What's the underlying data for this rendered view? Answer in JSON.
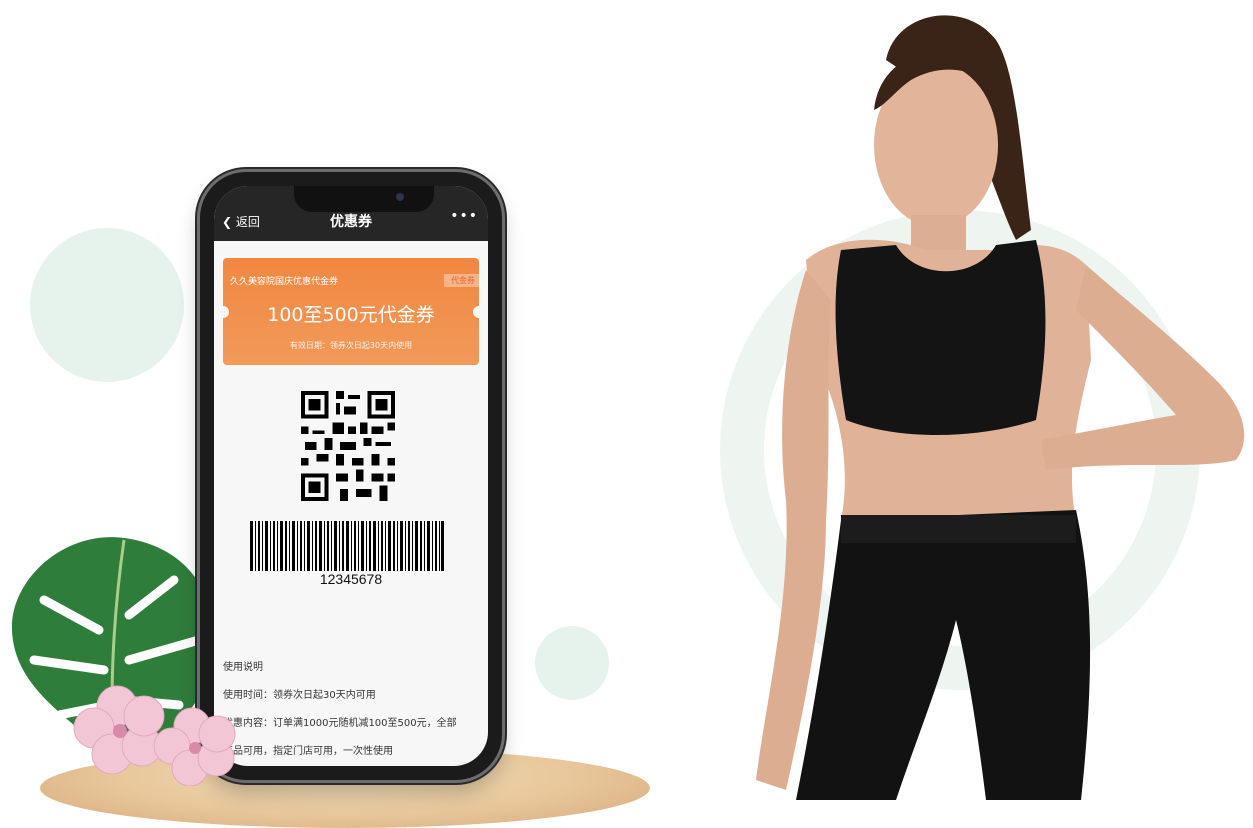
{
  "phone": {
    "nav": {
      "back_label": "返回",
      "title": "优惠券",
      "more": "•••"
    },
    "coupon": {
      "store": "久久美容院国庆优惠代金券",
      "tag": "代金券",
      "amount": "100至500元代金券",
      "validity": "有效日期：领券次日起30天内使用"
    },
    "barcode_number": "12345678",
    "usage": {
      "heading": "使用说明",
      "time": "使用时间：领券次日起30天内可用",
      "content_line1": "优惠内容：订单满1000元随机减100至500元，全部",
      "content_line2": "商品可用，指定门店可用，一次性使用"
    }
  },
  "colors": {
    "coupon_orange": "#f18740",
    "nav_bar": "#262626",
    "mint_circle": "#e6f2ec",
    "pedestal_wood": "#e7c69a"
  }
}
